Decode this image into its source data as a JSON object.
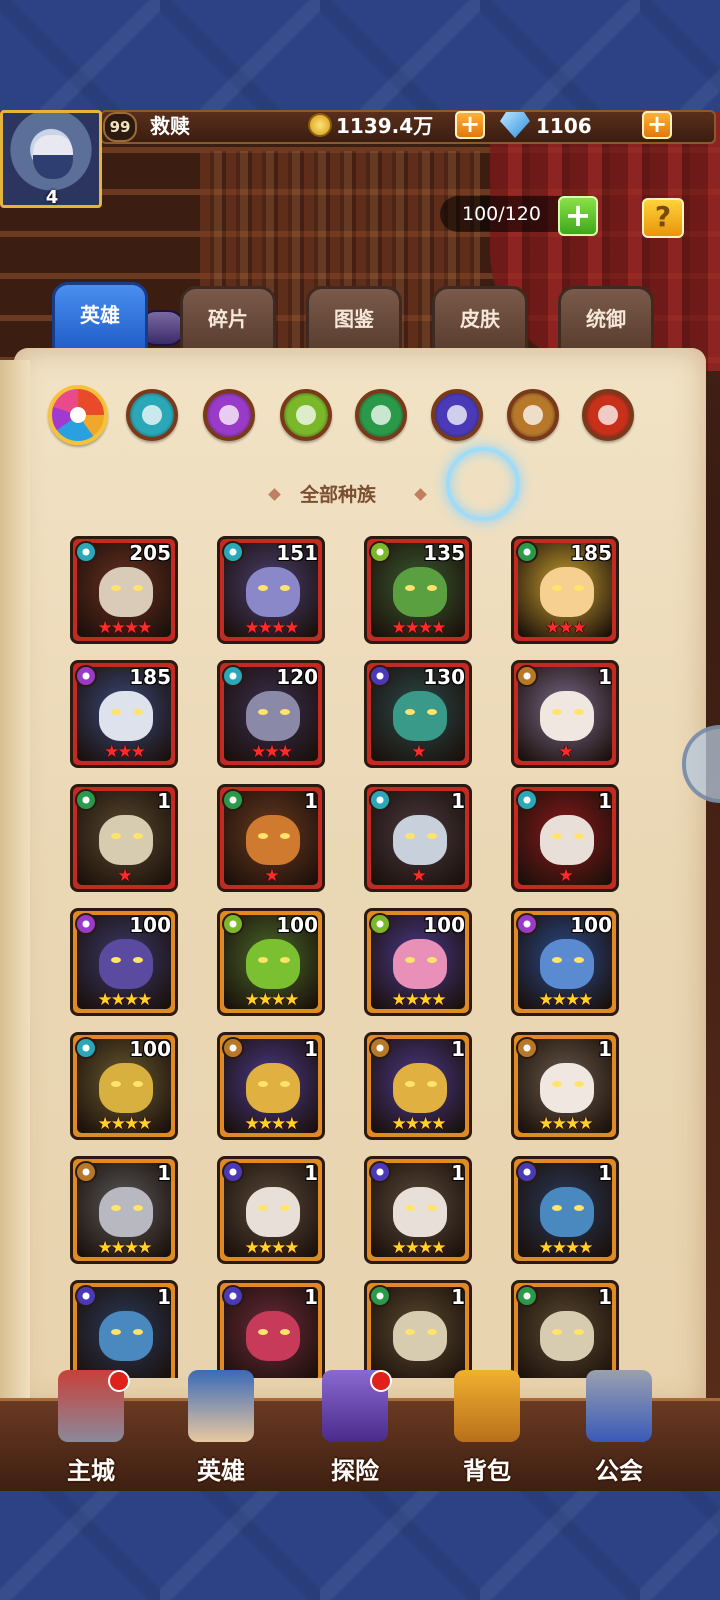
{
  "player": {
    "level": "99",
    "name": "救赎",
    "avatar_rank": "4",
    "gold": "1139.4万",
    "gems": "1106"
  },
  "capacity": "100/120",
  "help_label": "?",
  "tabs": [
    {
      "label": "英雄",
      "active": true
    },
    {
      "label": "碎片",
      "active": false
    },
    {
      "label": "图鉴",
      "active": false
    },
    {
      "label": "皮肤",
      "active": false
    },
    {
      "label": "统御",
      "active": false
    }
  ],
  "race_filters": [
    {
      "name": "all-races",
      "color": "#f5c23a"
    },
    {
      "name": "water",
      "color": "#2aa8b8"
    },
    {
      "name": "shadow",
      "color": "#9a3ac8"
    },
    {
      "name": "forest",
      "color": "#7ab82a"
    },
    {
      "name": "nature",
      "color": "#2a9a4a"
    },
    {
      "name": "undead",
      "color": "#4a3ab8"
    },
    {
      "name": "holy",
      "color": "#b8782a"
    },
    {
      "name": "demon",
      "color": "#c8301a"
    }
  ],
  "race_filter_label": "全部种族",
  "heroes": [
    {
      "level": "205",
      "stars": "★★★★",
      "star_color": "red",
      "frame": "red",
      "element_color": "#2aa8b8",
      "skin": "#d9cbb8",
      "bg": "#6a3020"
    },
    {
      "level": "151",
      "stars": "★★★★",
      "star_color": "red",
      "frame": "red",
      "element_color": "#2aa8b8",
      "skin": "#8a88c8",
      "bg": "#4a4070"
    },
    {
      "level": "135",
      "stars": "★★★★",
      "star_color": "red",
      "frame": "red",
      "element_color": "#7ab82a",
      "skin": "#5aa040",
      "bg": "#3a5a30"
    },
    {
      "level": "185",
      "stars": "★★★",
      "star_color": "red",
      "frame": "red",
      "element_color": "#2a9a4a",
      "skin": "#f5d090",
      "bg": "#c8a030"
    },
    {
      "level": "185",
      "stars": "★★★",
      "star_color": "red",
      "frame": "red",
      "element_color": "#9a3ac8",
      "skin": "#dde2ec",
      "bg": "#3a4a7a"
    },
    {
      "level": "120",
      "stars": "★★★",
      "star_color": "red",
      "frame": "red",
      "element_color": "#2aa8b8",
      "skin": "#8a8aa8",
      "bg": "#3a3050"
    },
    {
      "level": "130",
      "stars": "★",
      "star_color": "red",
      "frame": "red",
      "element_color": "#4a3ab8",
      "skin": "#3a9a8a",
      "bg": "#2a4a4a"
    },
    {
      "level": "1",
      "stars": "★",
      "star_color": "red",
      "frame": "red",
      "element_color": "#b8782a",
      "skin": "#f0e8e0",
      "bg": "#7a6a8a"
    },
    {
      "level": "1",
      "stars": "★",
      "star_color": "red",
      "frame": "red",
      "element_color": "#2a9a4a",
      "skin": "#d8ccb0",
      "bg": "#5a4a30"
    },
    {
      "level": "1",
      "stars": "★",
      "star_color": "red",
      "frame": "red",
      "element_color": "#2a9a4a",
      "skin": "#d07a30",
      "bg": "#6a3a20"
    },
    {
      "level": "1",
      "stars": "★",
      "star_color": "red",
      "frame": "red",
      "element_color": "#2aa8b8",
      "skin": "#c8d0dc",
      "bg": "#4a3a40"
    },
    {
      "level": "1",
      "stars": "★",
      "star_color": "red",
      "frame": "red",
      "element_color": "#2aa8b8",
      "skin": "#e8e0d8",
      "bg": "#8a1a1a"
    },
    {
      "level": "100",
      "stars": "★★★★",
      "star_color": "gold",
      "frame": "orange",
      "element_color": "#9a3ac8",
      "skin": "#5a4aa0",
      "bg": "#3a3a6a"
    },
    {
      "level": "100",
      "stars": "★★★★",
      "star_color": "gold",
      "frame": "orange",
      "element_color": "#7ab82a",
      "skin": "#7ac030",
      "bg": "#4a6a2a"
    },
    {
      "level": "100",
      "stars": "★★★★",
      "star_color": "gold",
      "frame": "orange",
      "element_color": "#7ab82a",
      "skin": "#e890b8",
      "bg": "#4a3a8a"
    },
    {
      "level": "100",
      "stars": "★★★★",
      "star_color": "gold",
      "frame": "orange",
      "element_color": "#9a3ac8",
      "skin": "#5a8ad0",
      "bg": "#2a4a8a"
    },
    {
      "level": "100",
      "stars": "★★★★",
      "star_color": "gold",
      "frame": "orange",
      "element_color": "#2aa8b8",
      "skin": "#d8b040",
      "bg": "#6a5a30"
    },
    {
      "level": "1",
      "stars": "★★★★",
      "star_color": "gold",
      "frame": "orange",
      "element_color": "#b8782a",
      "skin": "#e0b040",
      "bg": "#4a3a8a"
    },
    {
      "level": "1",
      "stars": "★★★★",
      "star_color": "gold",
      "frame": "orange",
      "element_color": "#b8782a",
      "skin": "#e0b040",
      "bg": "#4a3a8a"
    },
    {
      "level": "1",
      "stars": "★★★★",
      "star_color": "gold",
      "frame": "orange",
      "element_color": "#b8782a",
      "skin": "#f0e8e0",
      "bg": "#6a5a4a"
    },
    {
      "level": "1",
      "stars": "★★★★",
      "star_color": "gold",
      "frame": "orange",
      "element_color": "#b8782a",
      "skin": "#b8b8c0",
      "bg": "#5a5a5a"
    },
    {
      "level": "1",
      "stars": "★★★★",
      "star_color": "gold",
      "frame": "orange",
      "element_color": "#4a3ab8",
      "skin": "#e8e0d8",
      "bg": "#5a4a3a"
    },
    {
      "level": "1",
      "stars": "★★★★",
      "star_color": "gold",
      "frame": "orange",
      "element_color": "#4a3ab8",
      "skin": "#e8e0d8",
      "bg": "#5a4a3a"
    },
    {
      "level": "1",
      "stars": "★★★★",
      "star_color": "gold",
      "frame": "orange",
      "element_color": "#4a3ab8",
      "skin": "#4a88c0",
      "bg": "#2a3a5a"
    },
    {
      "level": "1",
      "stars": "",
      "star_color": "gold",
      "frame": "orange",
      "element_color": "#4a3ab8",
      "skin": "#4a88c0",
      "bg": "#2a3a5a"
    },
    {
      "level": "1",
      "stars": "",
      "star_color": "gold",
      "frame": "orange",
      "element_color": "#4a3ab8",
      "skin": "#c83a5a",
      "bg": "#6a2a3a"
    },
    {
      "level": "1",
      "stars": "",
      "star_color": "gold",
      "frame": "orange",
      "element_color": "#2a9a4a",
      "skin": "#d8ccb0",
      "bg": "#5a4a30"
    },
    {
      "level": "1",
      "stars": "",
      "star_color": "gold",
      "frame": "orange",
      "element_color": "#2a9a4a",
      "skin": "#d8ccb0",
      "bg": "#5a4a30"
    }
  ],
  "bottom_nav": [
    {
      "label": "主城",
      "icon": "castle-icon",
      "badge": true
    },
    {
      "label": "英雄",
      "icon": "hero-icon",
      "badge": false
    },
    {
      "label": "探险",
      "icon": "portal-icon",
      "badge": true
    },
    {
      "label": "背包",
      "icon": "bag-icon",
      "badge": false
    },
    {
      "label": "公会",
      "icon": "guild-icon",
      "badge": false
    }
  ]
}
